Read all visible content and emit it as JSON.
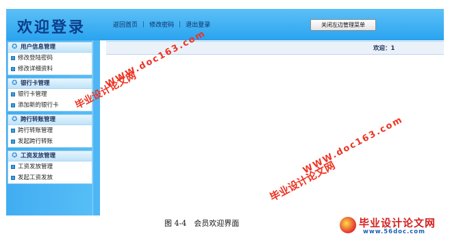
{
  "header": {
    "logo": "欢迎登录",
    "links": [
      "返回首页",
      "修改密码",
      "退出登录"
    ],
    "toggle_button": "关闭左边管理菜单"
  },
  "sidebar": {
    "groups": [
      {
        "title": "用户信息管理",
        "items": [
          "修改登陆密码",
          "修改详细资料"
        ]
      },
      {
        "title": "银行卡管理",
        "items": [
          "银行卡管理",
          "添加新的银行卡"
        ]
      },
      {
        "title": "跨行转账管理",
        "items": [
          "跨行转账管理",
          "发起跨行转账"
        ]
      },
      {
        "title": "工资发放管理",
        "items": [
          "工资发放管理",
          "发起工资发放"
        ]
      }
    ]
  },
  "main": {
    "welcome": "欢迎：1"
  },
  "caption": "图 4-4　会员欢迎界面",
  "watermarks": {
    "cn": "毕业设计论文网",
    "url": "WWW.doc163.com"
  },
  "brand": {
    "title": "毕业设计论文网",
    "url": "www.56doc.com"
  },
  "colors": {
    "header": "#2aa3ef",
    "sidebar": "#41adf2",
    "watermark": "#ee3322"
  }
}
